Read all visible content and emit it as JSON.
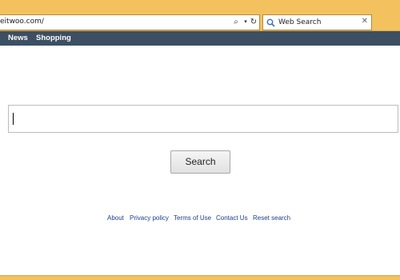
{
  "browser": {
    "address_text": "eitwoo.com/",
    "search_placeholder": "Web Search",
    "icons": {
      "search": "magnifier-icon",
      "dropdown": "dropdown-arrow-icon",
      "refresh": "refresh-icon",
      "close": "close-icon"
    },
    "chrome_color": "#f3c25e"
  },
  "nav": {
    "items": [
      {
        "label": "News"
      },
      {
        "label": "Shopping"
      }
    ],
    "background": "#3c4f63"
  },
  "main": {
    "search_value": "",
    "button_label": "Search"
  },
  "footer": {
    "links": [
      {
        "label": "About"
      },
      {
        "label": "Privacy policy"
      },
      {
        "label": "Terms of Use"
      },
      {
        "label": "Contact Us"
      },
      {
        "label": "Reset search"
      }
    ]
  }
}
